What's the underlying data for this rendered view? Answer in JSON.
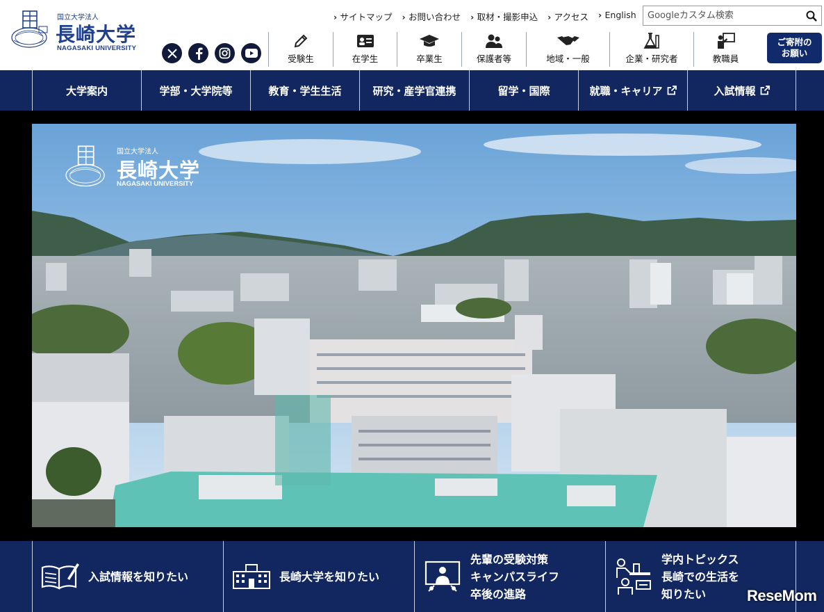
{
  "logo": {
    "sub": "国立大学法人",
    "main": "長崎大学",
    "en": "NAGASAKI UNIVERSITY"
  },
  "top_links": [
    "サイトマップ",
    "お問い合わせ",
    "取材・撮影申込",
    "アクセス",
    "English"
  ],
  "search": {
    "placeholder": "Googleカスタム検索"
  },
  "social": [
    "x-icon",
    "facebook-icon",
    "instagram-icon",
    "youtube-icon"
  ],
  "audience": [
    {
      "label": "受験生",
      "icon": "pencil-icon"
    },
    {
      "label": "在学生",
      "icon": "id-card-icon"
    },
    {
      "label": "卒業生",
      "icon": "graduation-cap-icon"
    },
    {
      "label": "保護者等",
      "icon": "people-icon"
    },
    {
      "label": "地域・一般",
      "icon": "handshake-icon"
    },
    {
      "label": "企業・研究者",
      "icon": "flask-icon"
    },
    {
      "label": "教職員",
      "icon": "teacher-icon"
    }
  ],
  "donate": {
    "line1": "ご寄附の",
    "line2": "お願い"
  },
  "nav": [
    {
      "label": "大学案内",
      "external": false
    },
    {
      "label": "学部・大学院等",
      "external": false
    },
    {
      "label": "教育・学生生活",
      "external": false
    },
    {
      "label": "研究・産学官連携",
      "external": false
    },
    {
      "label": "留学・国際",
      "external": false
    },
    {
      "label": "就職・キャリア",
      "external": true
    },
    {
      "label": "入試情報",
      "external": true
    }
  ],
  "hero": {
    "logo_sub": "国立大学法人",
    "logo_main": "長崎大学",
    "logo_en": "NAGASAKI UNIVERSITY"
  },
  "cards": [
    {
      "lines": [
        "入試情報を知りたい"
      ],
      "icon": "book-pen-icon"
    },
    {
      "lines": [
        "長崎大学を知りたい"
      ],
      "icon": "campus-building-icon"
    },
    {
      "lines": [
        "先輩の受験対策",
        "キャンパスライフ",
        "卒後の進路"
      ],
      "icon": "presentation-icon"
    },
    {
      "lines": [
        "学内トピックス",
        "長崎での生活を",
        "知りたい"
      ],
      "icon": "researcher-icon"
    }
  ],
  "watermark": "ReseMom"
}
